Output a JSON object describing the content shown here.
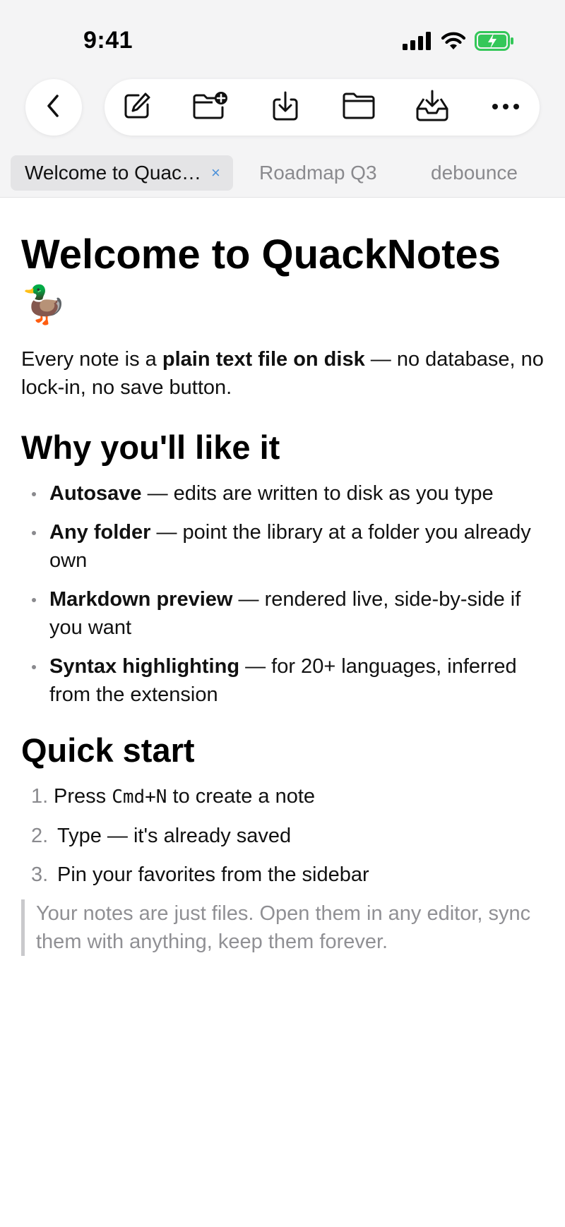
{
  "status": {
    "time": "9:41"
  },
  "toolbar": {
    "back": "back",
    "tools": [
      "new-note",
      "new-folder",
      "import",
      "open-folder",
      "inbox",
      "more"
    ]
  },
  "tabs": [
    {
      "label": "Welcome to Quac…",
      "close": "×",
      "active": true
    },
    {
      "label": "Roadmap Q3",
      "active": false
    },
    {
      "label": "debounce",
      "active": false
    }
  ],
  "doc": {
    "title": "Welcome to QuackNotes",
    "emoji": "🦆",
    "intro_pre": "Every note is a ",
    "intro_bold": "plain text file on disk",
    "intro_post": " — no database, no lock-in, no save button.",
    "why_heading": "Why you'll like it",
    "features": [
      {
        "name": "Autosave",
        "text": " — edits are written to disk as you type"
      },
      {
        "name": "Any folder",
        "text": " — point the library at a folder you already own"
      },
      {
        "name": "Markdown preview",
        "text": " — rendered live, side-by-side if you want"
      },
      {
        "name": "Syntax highlighting",
        "text": " — for 20+ languages, inferred from the extension"
      }
    ],
    "quick_heading": "Quick start",
    "steps": [
      {
        "num": "1.",
        "pre": "Press ",
        "code": "Cmd+N",
        "post": " to create a note"
      },
      {
        "num": "2.",
        "pre": "Type — it's already saved",
        "code": "",
        "post": ""
      },
      {
        "num": "3.",
        "pre": "Pin your favorites from the sidebar",
        "code": "",
        "post": ""
      }
    ],
    "quote": "Your notes are just files. Open them in any editor, sync them with anything, keep them forever."
  },
  "colors": {
    "accent": "#4a90d9",
    "battery": "#34c759",
    "muted": "#8a8a8e"
  }
}
